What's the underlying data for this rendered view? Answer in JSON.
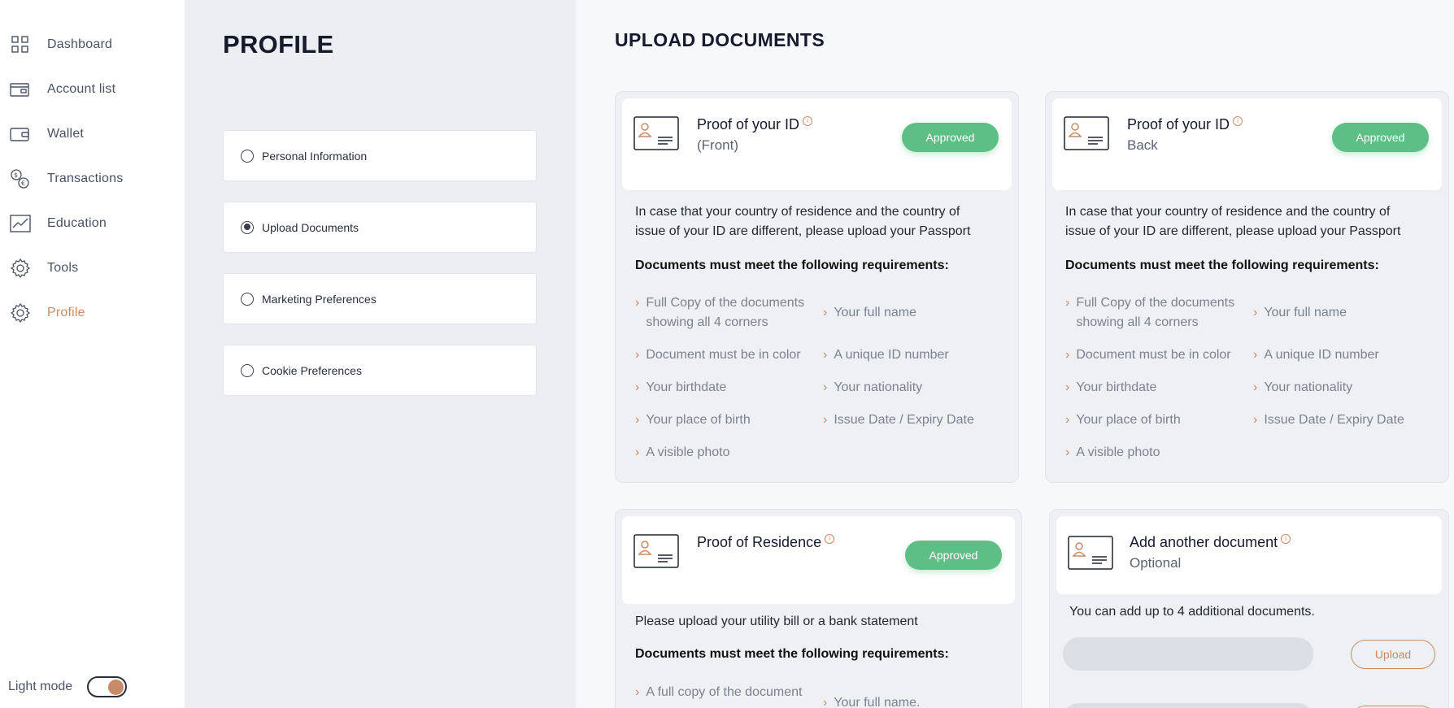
{
  "sidebar": {
    "items": [
      {
        "label": "Dashboard",
        "icon": "grid-icon"
      },
      {
        "label": "Account list",
        "icon": "card-icon"
      },
      {
        "label": "Wallet",
        "icon": "wallet-icon"
      },
      {
        "label": "Transactions",
        "icon": "exchange-icon"
      },
      {
        "label": "Education",
        "icon": "chart-icon"
      },
      {
        "label": "Tools",
        "icon": "gear-icon"
      },
      {
        "label": "Profile",
        "icon": "gear-icon",
        "active": true
      }
    ],
    "mode_label": "Light mode"
  },
  "profile": {
    "title": "PROFILE",
    "options": [
      {
        "label": "Personal Information",
        "checked": false
      },
      {
        "label": "Upload Documents",
        "checked": true
      },
      {
        "label": "Marketing Preferences",
        "checked": false
      },
      {
        "label": "Cookie Preferences",
        "checked": false
      }
    ]
  },
  "main": {
    "title": "UPLOAD DOCUMENTS",
    "info_glyph": "i",
    "req_heading": "Documents must meet the following requirements:",
    "id_front": {
      "title": "Proof of your ID",
      "subtitle": "(Front)",
      "status": "Approved",
      "description": "In case that your country of residence and the country of issue of your ID are different, please upload your Passport",
      "requirements_left": [
        "Full Copy of the documents showing all 4 corners",
        "Document must be in color",
        "Your birthdate",
        "Your place of birth",
        "A visible photo"
      ],
      "requirements_right": [
        "Your full name",
        "A unique ID number",
        "Your nationality",
        "Issue Date / Expiry Date"
      ]
    },
    "id_back": {
      "title": "Proof of your ID",
      "subtitle": "Back",
      "status": "Approved",
      "description": "In case that your country of residence and the country of issue of your ID are different, please upload your Passport",
      "requirements_left": [
        "Full Copy of the documents showing all 4 corners",
        "Document must be in color",
        "Your birthdate",
        "Your place of birth",
        "A visible photo"
      ],
      "requirements_right": [
        "Your full name",
        "A unique ID number",
        "Your nationality",
        "Issue Date / Expiry Date"
      ]
    },
    "residence": {
      "title": "Proof of Residence",
      "status": "Approved",
      "description": "Please upload your utility bill or a bank statement",
      "requirements_left": [
        "A full copy of the document"
      ],
      "requirements_right": [
        "Your full name."
      ]
    },
    "additional": {
      "title": "Add another document",
      "subtitle": "Optional",
      "description": "You can add up to 4 additional documents.",
      "upload_label": "Upload"
    }
  },
  "colors": {
    "accent": "#c98b67",
    "approved": "#5dbf86"
  }
}
